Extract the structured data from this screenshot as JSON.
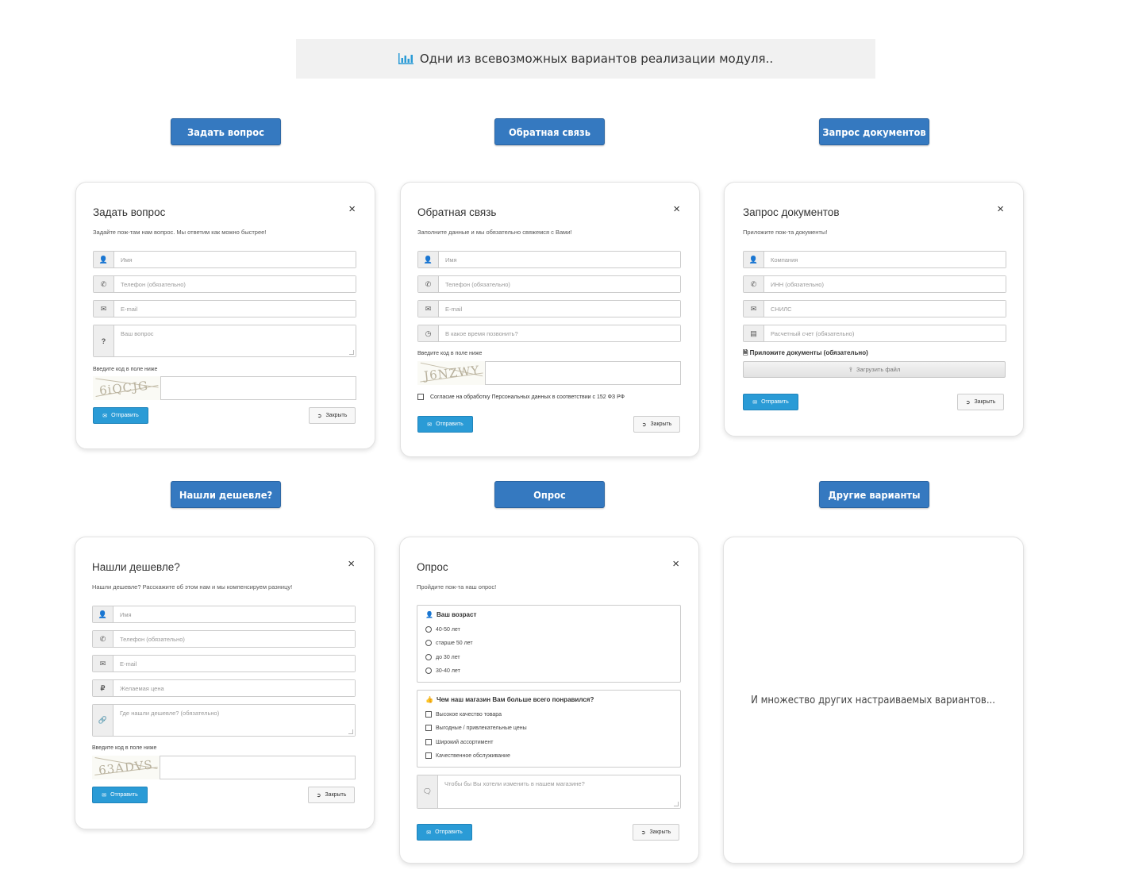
{
  "banner": {
    "text": "Одни из всевозможных вариантов реализации модуля..",
    "icon": "bar-chart-icon"
  },
  "triggers": [
    "Задать вопрос",
    "Обратная связь",
    "Запрос документов",
    "Нашли дешевле?",
    "Опрос",
    "Другие варианты"
  ],
  "common": {
    "captcha_label": "Введите код в поле ниже",
    "send": "Отправить",
    "close": "Закрыть",
    "close_x": "×"
  },
  "ask": {
    "title": "Задать вопрос",
    "subtitle": "Задайте пож-там нам вопрос. Мы ответим как можно быстрее!",
    "name_ph": "Имя",
    "phone_ph": "Телефон (обязательно)",
    "email_ph": "E-mail",
    "question_ph": "Ваш вопрос",
    "captcha_code": "6iQCJG"
  },
  "feedback": {
    "title": "Обратная связь",
    "subtitle": "Заполните данные и мы обязательно свяжемся с Вами!",
    "name_ph": "Имя",
    "phone_ph": "Телефон (обязательно)",
    "email_ph": "E-mail",
    "time_ph": "В какое время позвонить?",
    "captcha_code": "J6NZWY",
    "consent": "Согласие на обработку Персональных данных в соответствии с 152 ФЗ РФ"
  },
  "docs": {
    "title": "Запрос документов",
    "subtitle": "Приложите пож-та документы!",
    "company_ph": "Компания",
    "inn_ph": "ИНН (обязательно)",
    "snils_ph": "СНИЛС",
    "account_ph": "Расчетный счет (обязательно)",
    "attach_label": "Приложите документы (обязательно)",
    "upload": "Загрузить файл"
  },
  "cheaper": {
    "title": "Нашли дешевле?",
    "subtitle": "Нашли дешевле? Расскажите об этом нам и мы компенсируем разницу!",
    "name_ph": "Имя",
    "phone_ph": "Телефон (обязательно)",
    "email_ph": "E-mail",
    "price_ph": "Желаемая цена",
    "where_ph": "Где нашли дешевле? (обязательно)",
    "captcha_code": "63ADVS"
  },
  "poll": {
    "title": "Опрос",
    "subtitle": "Пройдите пож-та наш опрос!",
    "age_title": "Ваш возраст",
    "age_options": [
      "40-50 лет",
      "старше 50 лет",
      "до 30 лет",
      "30-40 лет"
    ],
    "like_title": "Чем наш магазин Вам больше всего понравился?",
    "like_options": [
      "Высокое качество товара",
      "Выгодные / привлекательные цены",
      "Широкий ассортимент",
      "Качественное обслуживание"
    ],
    "change_ph": "Чтобы бы Вы хотели изменить в нашем магазине?"
  },
  "other": {
    "text": "И множество других настраиваемых вариантов..."
  },
  "colors": {
    "primary_trigger": "#3579c0",
    "send_button": "#2a9bd6"
  }
}
